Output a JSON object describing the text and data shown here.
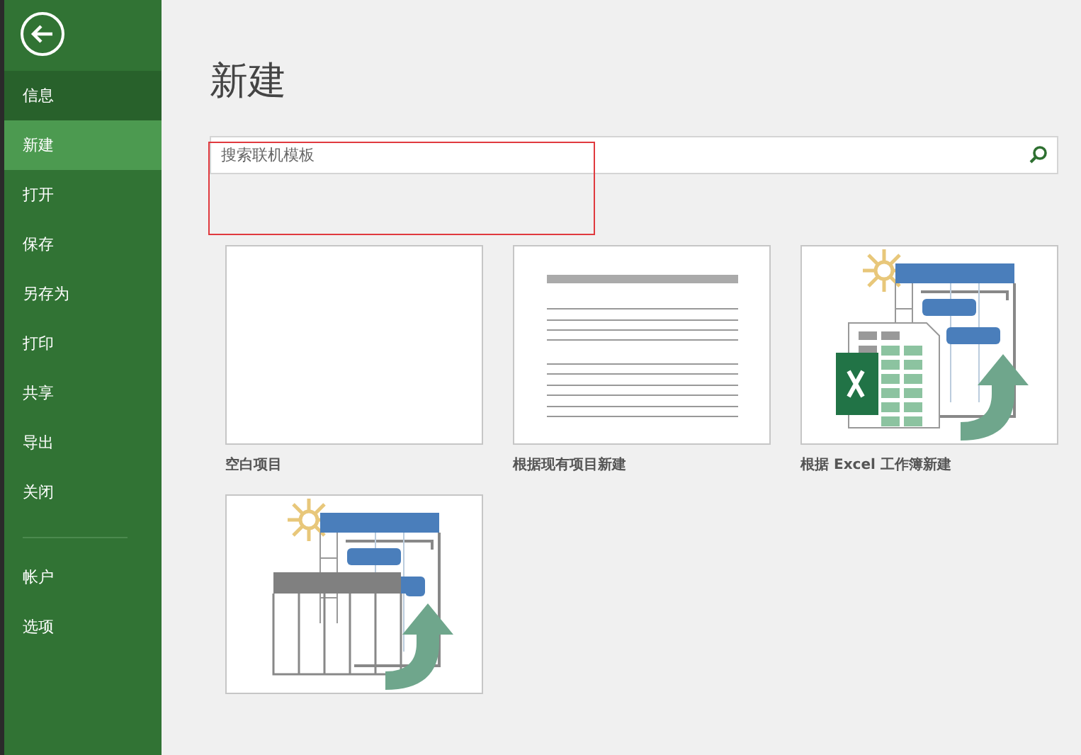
{
  "sidebar": {
    "items": [
      {
        "label": "信息",
        "selected": false,
        "kind": "info"
      },
      {
        "label": "新建",
        "selected": true
      },
      {
        "label": "打开",
        "selected": false
      },
      {
        "label": "保存",
        "selected": false
      },
      {
        "label": "另存为",
        "selected": false
      },
      {
        "label": "打印",
        "selected": false
      },
      {
        "label": "共享",
        "selected": false
      },
      {
        "label": "导出",
        "selected": false
      },
      {
        "label": "关闭",
        "selected": false
      },
      {
        "kind": "separator"
      },
      {
        "label": "帐户",
        "selected": false
      },
      {
        "label": "选项",
        "selected": false
      }
    ]
  },
  "heading": "新建",
  "search": {
    "placeholder": "搜索联机模板"
  },
  "templates": [
    {
      "kind": "blank",
      "label": "空白项目"
    },
    {
      "kind": "lines",
      "label": "根据现有项目新建"
    },
    {
      "kind": "excel",
      "label": "根据 Excel 工作簿新建"
    },
    {
      "kind": "table"
    }
  ]
}
